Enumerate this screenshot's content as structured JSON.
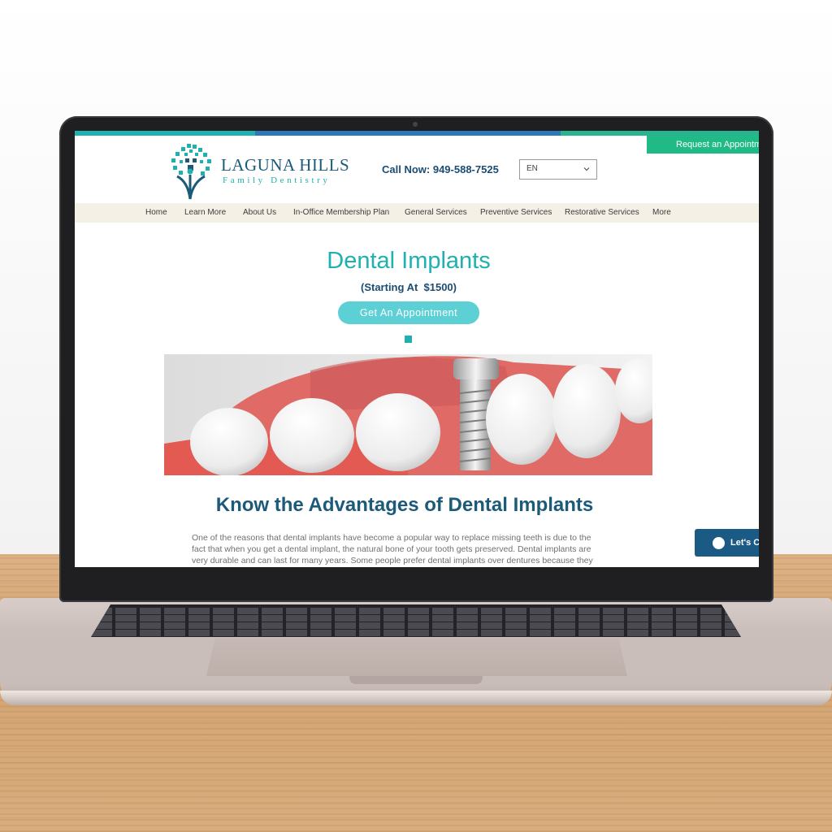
{
  "site": {
    "brand_name": "LAGUNA HILLS",
    "brand_sub": "Family Dentistry",
    "top_button": "Request an Appointment",
    "call_now": "Call Now: 949-588-7525",
    "language": "EN"
  },
  "nav": {
    "items": [
      {
        "label": "Home"
      },
      {
        "label": "Learn More"
      },
      {
        "label": "About Us"
      },
      {
        "label": "In-Office Membership Plan"
      },
      {
        "label": "General Services"
      },
      {
        "label": "Preventive Services"
      },
      {
        "label": "Restorative Services"
      },
      {
        "label": "More"
      }
    ]
  },
  "main": {
    "title": "Dental Implants",
    "price_note": "(Starting At  $1500)",
    "appointment_button": "Get An Appointment",
    "section_heading": "Know the Advantages of Dental Implants",
    "paragraph_lines": [
      "One of the reasons that dental implants have become a popular way to replace missing teeth is due to the",
      "fact that when you get a dental implant, the natural bone of your tooth gets preserved. Dental implants are",
      "very durable and can last for many years. Some people prefer dental implants over dentures because they"
    ]
  },
  "chat": {
    "label": "Let's Chat!",
    "icon": "chat-bubble-icon"
  },
  "colors": {
    "teal": "#1fb1b2",
    "navy": "#1c5a7a",
    "green": "#1fba86",
    "button": "#5cd0d4",
    "nav_bg": "#f5f0e6"
  }
}
